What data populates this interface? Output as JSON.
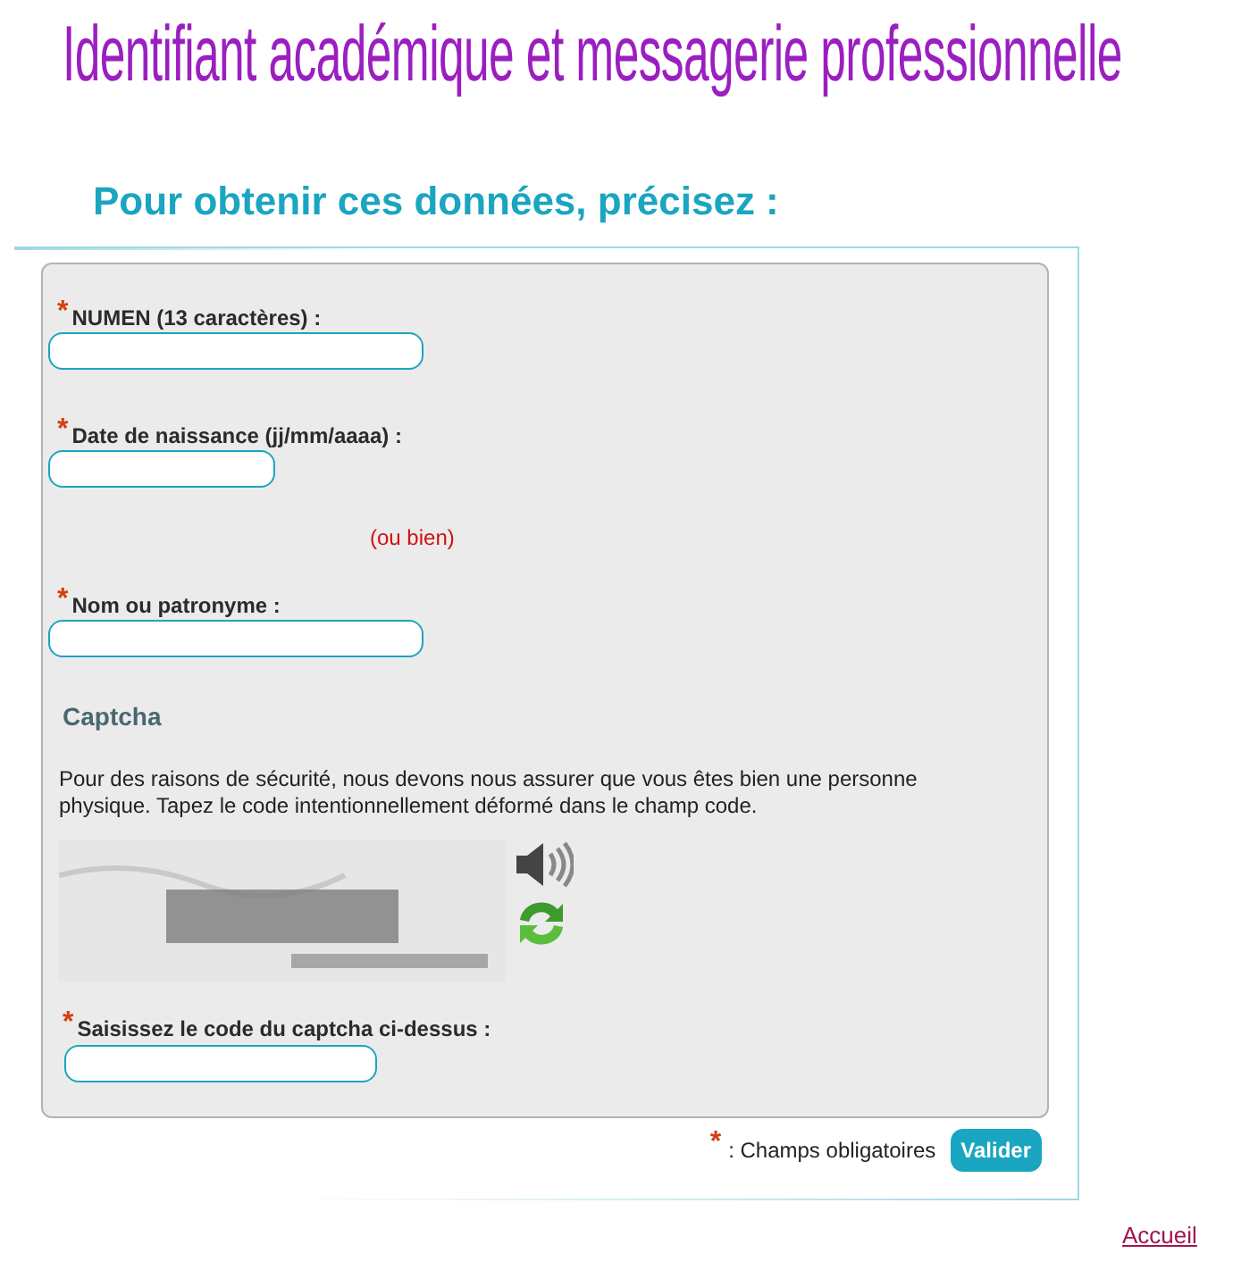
{
  "title": "Identifiant académique et messagerie professionnelle",
  "subtitle": "Pour obtenir ces données, précisez :",
  "form": {
    "required_mark": "*",
    "items": [
      {
        "kind": "field",
        "label": "NUMEN (13 caractères) :",
        "required": true
      },
      {
        "kind": "date",
        "label": "Date de naissance (jj/mm/aaaa) :",
        "required": true
      },
      {
        "kind": "separator",
        "text": "(ou bien)"
      },
      {
        "kind": "field",
        "label": "Nom ou patronyme :",
        "required": true
      }
    ],
    "captcha": {
      "heading": "Captcha",
      "instructions": "Pour des raisons de sécurité, nous devons nous assurer que vous êtes bien une personne physique. Tapez le code intentionnellement déformé dans le champ code.",
      "field": {
        "label": "Saisissez le code du captcha ci-dessus :",
        "required": true
      }
    }
  },
  "footer": {
    "legend": {
      "mark": "*",
      "text": ": Champs obligatoires"
    },
    "button": "Valider",
    "link": "Accueil"
  }
}
